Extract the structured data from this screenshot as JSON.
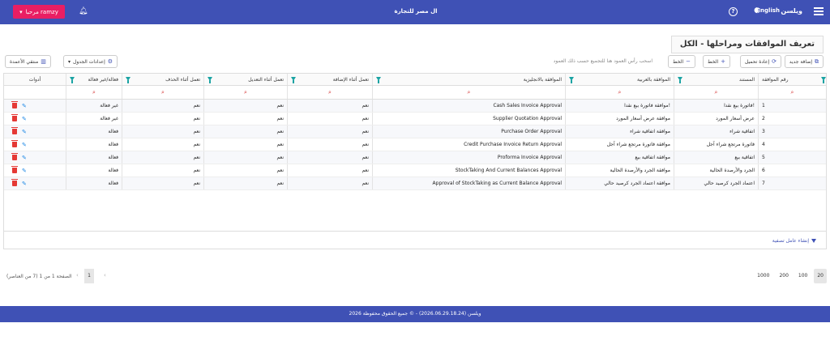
{
  "topbar": {
    "brand": "ويلسن",
    "lang": "English",
    "company": "ال مصر للتجارة",
    "user_label": "مرحبا ramzy"
  },
  "page": {
    "title": "تعريف الموافقات ومراحلها - الكل"
  },
  "toolbar": {
    "add_new": "إضافة جديد",
    "reload": "إعادة تحميل",
    "line_plus": "الخط",
    "line_minus": "الخط",
    "group_hint": "اسحب رأس العمود هنا للتجميع حسب ذلك العمود",
    "table_settings": "إعدادات الجدول",
    "column_chooser": "منتقي الأعمدة"
  },
  "columns": {
    "num": "رقم الموافقة",
    "doc": "المستند",
    "ar": "الموافقة بالعربية",
    "en": "الموافقة بالانجليزية",
    "add": "تعمل أثناء الإضافة",
    "edit": "تعمل أثناء التعديل",
    "del": "تعمل أثناء الحذف",
    "active": "فعالة/غير فعالة",
    "tools": "أدوات"
  },
  "rows": [
    {
      "num": "1",
      "doc": "فاتورة بيع نقدا!",
      "ar": "موافقة فاتورة بيع نقدا!",
      "en": "Cash Sales Invoice Approval",
      "add": "نعم",
      "edit": "نعم",
      "del": "نعم",
      "active": "غير فعالة"
    },
    {
      "num": "2",
      "doc": "عرض أسعار المورد",
      "ar": "موافقة عرض أسعار المورد",
      "en": "Supplier Quotation Approval",
      "add": "نعم",
      "edit": "نعم",
      "del": "نعم",
      "active": "غير فعالة"
    },
    {
      "num": "3",
      "doc": "اتفاقية شراء",
      "ar": "موافقة اتفاقية شراء",
      "en": "Purchase Order Approval",
      "add": "نعم",
      "edit": "نعم",
      "del": "نعم",
      "active": "فعالة"
    },
    {
      "num": "4",
      "doc": "فاتورة مرتجع شراء آجل",
      "ar": "موافقة فاتورة مرتجع شراء آجل",
      "en": "Credit Purchase Invoice Return Approval",
      "add": "نعم",
      "edit": "نعم",
      "del": "نعم",
      "active": "فعالة"
    },
    {
      "num": "5",
      "doc": "اتفاقية بيع",
      "ar": "موافقة اتفاقية بيع",
      "en": "Proforma Invoice Approval",
      "add": "نعم",
      "edit": "نعم",
      "del": "نعم",
      "active": "فعالة"
    },
    {
      "num": "6",
      "doc": "الجرد والأرصدة الحالية",
      "ar": "موافقة الجرد والأرصدة الحالية",
      "en": "StockTaking And Current Balances Approval",
      "add": "نعم",
      "edit": "نعم",
      "del": "نعم",
      "active": "فعالة"
    },
    {
      "num": "7",
      "doc": "اعتماد الجرد كرصيد حالي",
      "ar": "موافقة اعتماد الجرد كرصيد حالي",
      "en": "Approval of StockTaking as Current Balance Approval",
      "add": "نعم",
      "edit": "نعم",
      "del": "نعم",
      "active": "فعالة"
    }
  ],
  "grid": {
    "filter_builder": "إنشاء عامل تصفية"
  },
  "pager": {
    "info": "الصفحة 1 من 1 (7 من العناصر)",
    "page": "1",
    "sizes": [
      "20",
      "100",
      "200",
      "1000"
    ],
    "selected_size": "20"
  },
  "footer": {
    "text": "ويلسن (2026.06.29.18.24) - © جميع الحقوق محفوظة 2026"
  },
  "colors": {
    "primary": "#3f51b5",
    "accent": "#e91e63",
    "filter_icon": "#1aa3a3",
    "delete": "#e53935",
    "edit": "#1e88e5"
  }
}
